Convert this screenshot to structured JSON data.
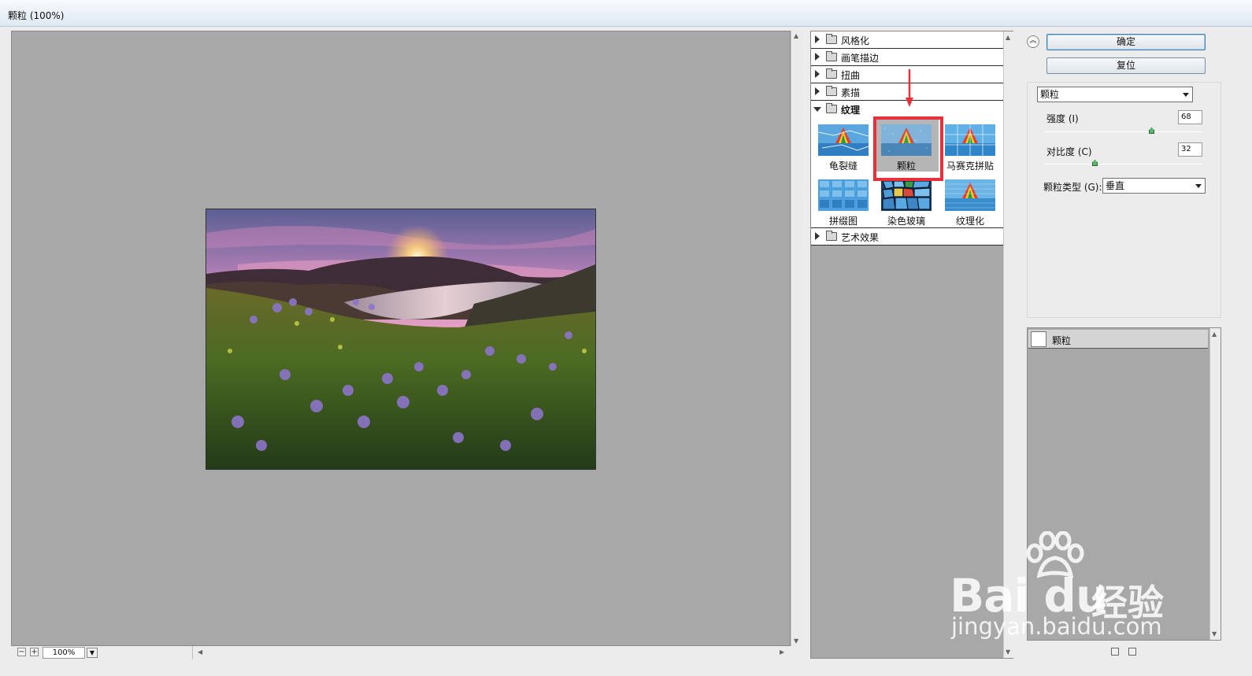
{
  "window": {
    "title": "颗粒 (100%)"
  },
  "preview": {
    "zoom": "100%"
  },
  "gallery": {
    "categories": [
      {
        "label": "风格化",
        "expanded": false
      },
      {
        "label": "画笔描边",
        "expanded": false
      },
      {
        "label": "扭曲",
        "expanded": false
      },
      {
        "label": "素描",
        "expanded": false
      },
      {
        "label": "纹理",
        "expanded": true
      },
      {
        "label": "艺术效果",
        "expanded": false
      }
    ],
    "texture_filters": [
      {
        "label": "龟裂缝",
        "selected": false
      },
      {
        "label": "颗粒",
        "selected": true
      },
      {
        "label": "马赛克拼贴",
        "selected": false
      },
      {
        "label": "拼缀图",
        "selected": false
      },
      {
        "label": "染色玻璃",
        "selected": false
      },
      {
        "label": "纹理化",
        "selected": false
      }
    ]
  },
  "buttons": {
    "ok": "确定",
    "reset": "复位"
  },
  "settings": {
    "filter_select": "颗粒",
    "intensity": {
      "label": "强度 (I)",
      "value": "68",
      "level": 68
    },
    "contrast": {
      "label": "对比度 (C)",
      "value": "32",
      "level": 32
    },
    "grain_type": {
      "label": "颗粒类型 (G):",
      "value": "垂直"
    }
  },
  "layers": [
    {
      "name": "颗粒"
    }
  ],
  "watermark": {
    "brand": "Bai du",
    "cn": "经验",
    "url": "jingyan.baidu.com"
  },
  "colors": {
    "highlight": "#e8303a",
    "slider_knob": "#5bb86a",
    "canvas_bg": "#a8a8a8"
  }
}
